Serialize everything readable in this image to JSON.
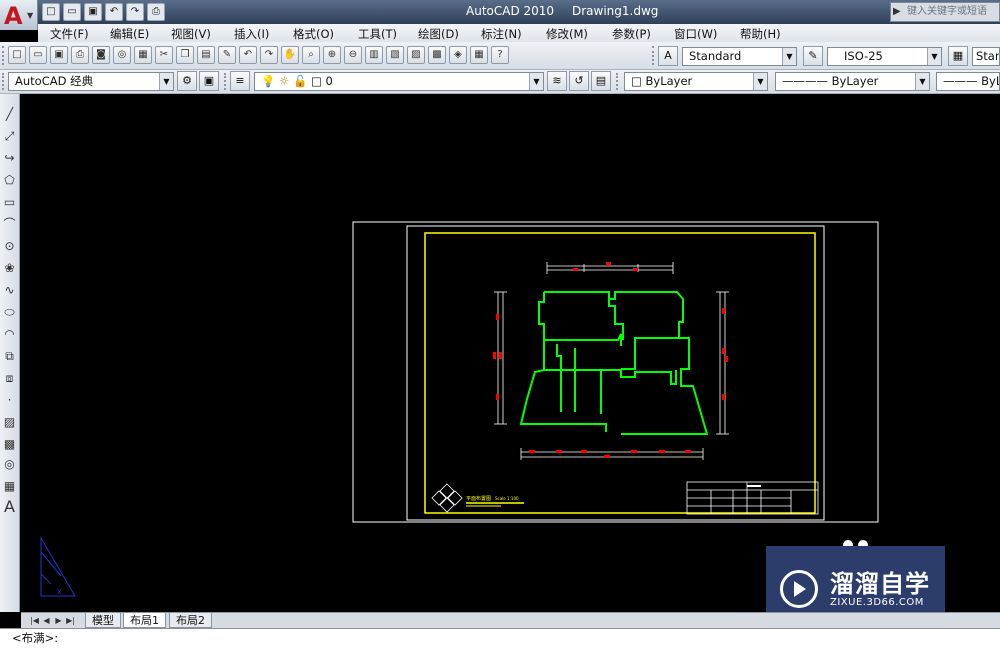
{
  "window": {
    "app_title": "AutoCAD 2010",
    "document_title": "Drawing1.dwg",
    "search_placeholder": "键入关键字或短语"
  },
  "menu": {
    "items": [
      "文件(F)",
      "编辑(E)",
      "视图(V)",
      "插入(I)",
      "格式(O)",
      "工具(T)",
      "绘图(D)",
      "标注(N)",
      "修改(M)",
      "参数(P)",
      "窗口(W)",
      "帮助(H)"
    ]
  },
  "toolbar": {
    "text_style": "Standard",
    "dim_style": "ISO-25",
    "table_style": "Stan",
    "workspace": "AutoCAD 经典",
    "layer": "0",
    "color": "ByLayer",
    "linetype": "ByLayer",
    "lineweight": "ByLa"
  },
  "icons": {
    "qat": [
      "new-icon",
      "open-icon",
      "save-icon",
      "undo-icon",
      "redo-icon",
      "print-icon"
    ],
    "standard": [
      "new-icon",
      "open-icon",
      "save-icon",
      "print-icon",
      "preview-icon",
      "publish-icon",
      "plot-icon",
      "cut-icon",
      "copy-icon",
      "paste-icon",
      "match-icon",
      "undo-icon",
      "redo-icon",
      "pan-icon",
      "zoom-icon",
      "zoom-window-icon",
      "zoom-previous-icon",
      "properties-icon",
      "design-center-icon",
      "tool-palette-icon",
      "sheet-set-icon",
      "markup-icon",
      "calculator-icon",
      "help-icon"
    ],
    "left": [
      "line-icon",
      "construction-line-icon",
      "polyline-icon",
      "polygon-icon",
      "rectangle-icon",
      "arc-icon",
      "circle-icon",
      "revision-cloud-icon",
      "spline-icon",
      "ellipse-icon",
      "ellipse-arc-icon",
      "insert-block-icon",
      "make-block-icon",
      "point-icon",
      "hatch-icon",
      "gradient-icon",
      "region-icon",
      "table-icon",
      "mtext-icon"
    ]
  },
  "tabs": {
    "model": "模型",
    "layout1": "布局1",
    "layout2": "布局2",
    "active": "layout1"
  },
  "command_line": {
    "text": "<布满>:"
  },
  "drawing": {
    "title_block_label": "平面布置图",
    "scale_label": "Scale 1:100",
    "colors": {
      "paper": "#ffffff",
      "border": "#ffff00",
      "walls": "#00ff00",
      "dimensions": "#ffffff",
      "markers": "#ff0000",
      "ucs": "#2233cc"
    }
  },
  "watermark": {
    "name": "溜溜自学",
    "url": "ZIXUE.3D66.COM"
  }
}
